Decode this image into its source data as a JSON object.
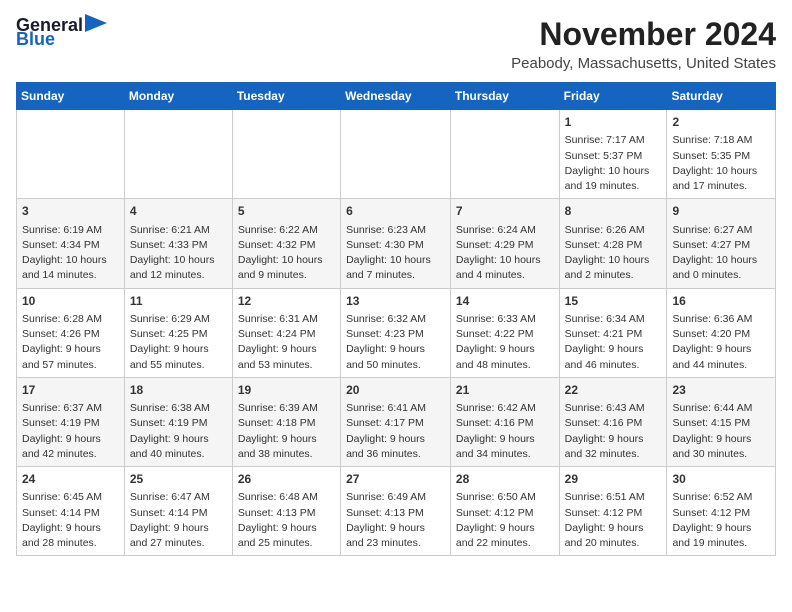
{
  "logo": {
    "line1": "General",
    "line2": "Blue"
  },
  "title": "November 2024",
  "subtitle": "Peabody, Massachusetts, United States",
  "headers": [
    "Sunday",
    "Monday",
    "Tuesday",
    "Wednesday",
    "Thursday",
    "Friday",
    "Saturday"
  ],
  "weeks": [
    [
      {
        "day": "",
        "info": ""
      },
      {
        "day": "",
        "info": ""
      },
      {
        "day": "",
        "info": ""
      },
      {
        "day": "",
        "info": ""
      },
      {
        "day": "",
        "info": ""
      },
      {
        "day": "1",
        "info": "Sunrise: 7:17 AM\nSunset: 5:37 PM\nDaylight: 10 hours and 19 minutes."
      },
      {
        "day": "2",
        "info": "Sunrise: 7:18 AM\nSunset: 5:35 PM\nDaylight: 10 hours and 17 minutes."
      }
    ],
    [
      {
        "day": "3",
        "info": "Sunrise: 6:19 AM\nSunset: 4:34 PM\nDaylight: 10 hours and 14 minutes."
      },
      {
        "day": "4",
        "info": "Sunrise: 6:21 AM\nSunset: 4:33 PM\nDaylight: 10 hours and 12 minutes."
      },
      {
        "day": "5",
        "info": "Sunrise: 6:22 AM\nSunset: 4:32 PM\nDaylight: 10 hours and 9 minutes."
      },
      {
        "day": "6",
        "info": "Sunrise: 6:23 AM\nSunset: 4:30 PM\nDaylight: 10 hours and 7 minutes."
      },
      {
        "day": "7",
        "info": "Sunrise: 6:24 AM\nSunset: 4:29 PM\nDaylight: 10 hours and 4 minutes."
      },
      {
        "day": "8",
        "info": "Sunrise: 6:26 AM\nSunset: 4:28 PM\nDaylight: 10 hours and 2 minutes."
      },
      {
        "day": "9",
        "info": "Sunrise: 6:27 AM\nSunset: 4:27 PM\nDaylight: 10 hours and 0 minutes."
      }
    ],
    [
      {
        "day": "10",
        "info": "Sunrise: 6:28 AM\nSunset: 4:26 PM\nDaylight: 9 hours and 57 minutes."
      },
      {
        "day": "11",
        "info": "Sunrise: 6:29 AM\nSunset: 4:25 PM\nDaylight: 9 hours and 55 minutes."
      },
      {
        "day": "12",
        "info": "Sunrise: 6:31 AM\nSunset: 4:24 PM\nDaylight: 9 hours and 53 minutes."
      },
      {
        "day": "13",
        "info": "Sunrise: 6:32 AM\nSunset: 4:23 PM\nDaylight: 9 hours and 50 minutes."
      },
      {
        "day": "14",
        "info": "Sunrise: 6:33 AM\nSunset: 4:22 PM\nDaylight: 9 hours and 48 minutes."
      },
      {
        "day": "15",
        "info": "Sunrise: 6:34 AM\nSunset: 4:21 PM\nDaylight: 9 hours and 46 minutes."
      },
      {
        "day": "16",
        "info": "Sunrise: 6:36 AM\nSunset: 4:20 PM\nDaylight: 9 hours and 44 minutes."
      }
    ],
    [
      {
        "day": "17",
        "info": "Sunrise: 6:37 AM\nSunset: 4:19 PM\nDaylight: 9 hours and 42 minutes."
      },
      {
        "day": "18",
        "info": "Sunrise: 6:38 AM\nSunset: 4:19 PM\nDaylight: 9 hours and 40 minutes."
      },
      {
        "day": "19",
        "info": "Sunrise: 6:39 AM\nSunset: 4:18 PM\nDaylight: 9 hours and 38 minutes."
      },
      {
        "day": "20",
        "info": "Sunrise: 6:41 AM\nSunset: 4:17 PM\nDaylight: 9 hours and 36 minutes."
      },
      {
        "day": "21",
        "info": "Sunrise: 6:42 AM\nSunset: 4:16 PM\nDaylight: 9 hours and 34 minutes."
      },
      {
        "day": "22",
        "info": "Sunrise: 6:43 AM\nSunset: 4:16 PM\nDaylight: 9 hours and 32 minutes."
      },
      {
        "day": "23",
        "info": "Sunrise: 6:44 AM\nSunset: 4:15 PM\nDaylight: 9 hours and 30 minutes."
      }
    ],
    [
      {
        "day": "24",
        "info": "Sunrise: 6:45 AM\nSunset: 4:14 PM\nDaylight: 9 hours and 28 minutes."
      },
      {
        "day": "25",
        "info": "Sunrise: 6:47 AM\nSunset: 4:14 PM\nDaylight: 9 hours and 27 minutes."
      },
      {
        "day": "26",
        "info": "Sunrise: 6:48 AM\nSunset: 4:13 PM\nDaylight: 9 hours and 25 minutes."
      },
      {
        "day": "27",
        "info": "Sunrise: 6:49 AM\nSunset: 4:13 PM\nDaylight: 9 hours and 23 minutes."
      },
      {
        "day": "28",
        "info": "Sunrise: 6:50 AM\nSunset: 4:12 PM\nDaylight: 9 hours and 22 minutes."
      },
      {
        "day": "29",
        "info": "Sunrise: 6:51 AM\nSunset: 4:12 PM\nDaylight: 9 hours and 20 minutes."
      },
      {
        "day": "30",
        "info": "Sunrise: 6:52 AM\nSunset: 4:12 PM\nDaylight: 9 hours and 19 minutes."
      }
    ]
  ]
}
